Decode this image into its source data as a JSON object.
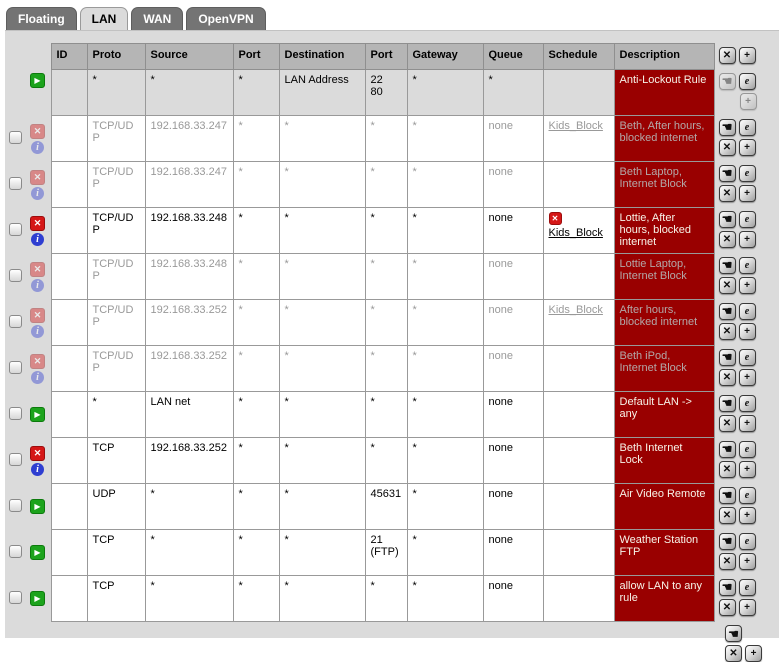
{
  "tabs": [
    {
      "label": "Floating",
      "active": false
    },
    {
      "label": "LAN",
      "active": true
    },
    {
      "label": "WAN",
      "active": false
    },
    {
      "label": "OpenVPN",
      "active": false
    }
  ],
  "icons": {
    "pass": "▶",
    "block": "✕",
    "info": "i",
    "move": "☚",
    "edit": "e",
    "delete": "✕",
    "add": "+",
    "schedule_active": "✕"
  },
  "colors": {
    "panel": "#dbdbdb",
    "header_bg": "#b5b5b5",
    "tab_inactive": "#747474",
    "description_bg": "#990000",
    "pass_green": "#1ca31c",
    "block_red": "#d51717",
    "info_blue": "#2e3ed1",
    "disabled_text": "#999999"
  },
  "table": {
    "headers": [
      "ID",
      "Proto",
      "Source",
      "Port",
      "Destination",
      "Port",
      "Gateway",
      "Queue",
      "Schedule",
      "Description"
    ],
    "rows": [
      {
        "action": "pass",
        "disabled": false,
        "checkbox": false,
        "info": false,
        "gray": true,
        "id": "",
        "proto": "*",
        "source": "*",
        "src_port": "*",
        "destination": "LAN Address",
        "dst_port": "22\n80",
        "gateway": "*",
        "queue": "*",
        "schedule": "",
        "schedule_icon": false,
        "description": "Anti-Lockout Rule",
        "antilockout": true
      },
      {
        "action": "block",
        "disabled": true,
        "checkbox": true,
        "info": true,
        "gray": false,
        "id": "",
        "proto": "TCP/UDP",
        "source": "192.168.33.247",
        "src_port": "*",
        "destination": "*",
        "dst_port": "*",
        "gateway": "*",
        "queue": "none",
        "schedule": "Kids_Block",
        "schedule_icon": false,
        "description": "Beth, After hours, blocked internet",
        "antilockout": false
      },
      {
        "action": "block",
        "disabled": true,
        "checkbox": true,
        "info": true,
        "gray": false,
        "id": "",
        "proto": "TCP/UDP",
        "source": "192.168.33.247",
        "src_port": "*",
        "destination": "*",
        "dst_port": "*",
        "gateway": "*",
        "queue": "none",
        "schedule": "",
        "schedule_icon": false,
        "description": "Beth Laptop, Internet Block",
        "antilockout": false
      },
      {
        "action": "block",
        "disabled": false,
        "checkbox": true,
        "info": true,
        "gray": false,
        "id": "",
        "proto": "TCP/UDP",
        "source": "192.168.33.248",
        "src_port": "*",
        "destination": "*",
        "dst_port": "*",
        "gateway": "*",
        "queue": "none",
        "schedule": "Kids_Block",
        "schedule_icon": true,
        "description": "Lottie, After hours, blocked internet",
        "antilockout": false
      },
      {
        "action": "block",
        "disabled": true,
        "checkbox": true,
        "info": true,
        "gray": false,
        "id": "",
        "proto": "TCP/UDP",
        "source": "192.168.33.248",
        "src_port": "*",
        "destination": "*",
        "dst_port": "*",
        "gateway": "*",
        "queue": "none",
        "schedule": "",
        "schedule_icon": false,
        "description": "Lottie Laptop, Internet Block",
        "antilockout": false
      },
      {
        "action": "block",
        "disabled": true,
        "checkbox": true,
        "info": true,
        "gray": false,
        "id": "",
        "proto": "TCP/UDP",
        "source": "192.168.33.252",
        "src_port": "*",
        "destination": "*",
        "dst_port": "*",
        "gateway": "*",
        "queue": "none",
        "schedule": "Kids_Block",
        "schedule_icon": false,
        "description": "After hours, blocked internet",
        "antilockout": false
      },
      {
        "action": "block",
        "disabled": true,
        "checkbox": true,
        "info": true,
        "gray": false,
        "id": "",
        "proto": "TCP/UDP",
        "source": "192.168.33.252",
        "src_port": "*",
        "destination": "*",
        "dst_port": "*",
        "gateway": "*",
        "queue": "none",
        "schedule": "",
        "schedule_icon": false,
        "description": "Beth iPod, Internet Block",
        "antilockout": false
      },
      {
        "action": "pass",
        "disabled": false,
        "checkbox": true,
        "info": false,
        "gray": false,
        "id": "",
        "proto": "*",
        "source": "LAN net",
        "src_port": "*",
        "destination": "*",
        "dst_port": "*",
        "gateway": "*",
        "queue": "none",
        "schedule": "",
        "schedule_icon": false,
        "description": "Default LAN -> any",
        "antilockout": false
      },
      {
        "action": "block",
        "disabled": false,
        "checkbox": true,
        "info": true,
        "gray": false,
        "id": "",
        "proto": "TCP",
        "source": "192.168.33.252",
        "src_port": "*",
        "destination": "*",
        "dst_port": "*",
        "gateway": "*",
        "queue": "none",
        "schedule": "",
        "schedule_icon": false,
        "description": "Beth Internet Lock",
        "antilockout": false
      },
      {
        "action": "pass",
        "disabled": false,
        "checkbox": true,
        "info": false,
        "gray": false,
        "id": "",
        "proto": "UDP",
        "source": "*",
        "src_port": "*",
        "destination": "*",
        "dst_port": "45631",
        "gateway": "*",
        "queue": "none",
        "schedule": "",
        "schedule_icon": false,
        "description": "Air Video Remote",
        "antilockout": false
      },
      {
        "action": "pass",
        "disabled": false,
        "checkbox": true,
        "info": false,
        "gray": false,
        "id": "",
        "proto": "TCP",
        "source": "*",
        "src_port": "*",
        "destination": "*",
        "dst_port": "21 (FTP)",
        "gateway": "*",
        "queue": "none",
        "schedule": "",
        "schedule_icon": false,
        "description": "Weather Station FTP",
        "antilockout": false
      },
      {
        "action": "pass",
        "disabled": false,
        "checkbox": true,
        "info": false,
        "gray": false,
        "id": "",
        "proto": "TCP",
        "source": "*",
        "src_port": "*",
        "destination": "*",
        "dst_port": "*",
        "gateway": "*",
        "queue": "none",
        "schedule": "",
        "schedule_icon": false,
        "description": "allow LAN to any rule",
        "antilockout": false
      }
    ]
  }
}
